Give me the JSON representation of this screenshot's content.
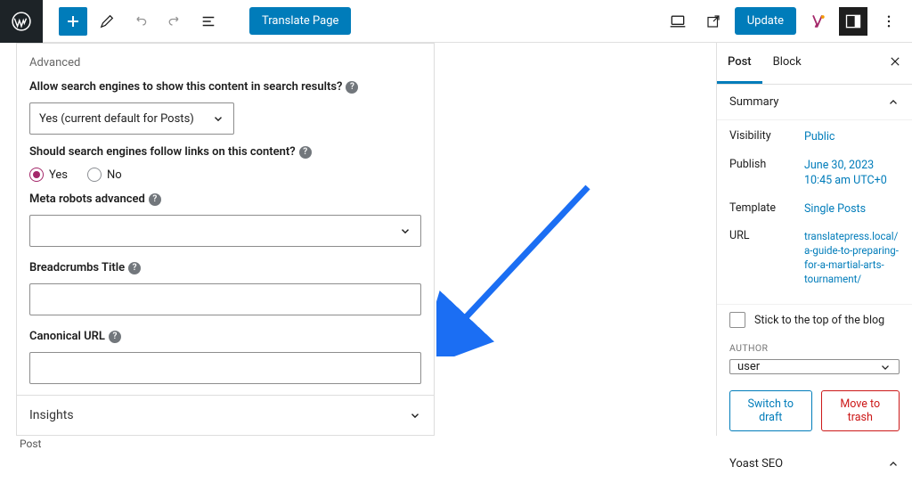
{
  "toolbar": {
    "translate_label": "Translate Page",
    "update_label": "Update"
  },
  "seo": {
    "advanced_header": "Advanced",
    "allow_search_label": "Allow search engines to show this content in search results?",
    "allow_search_value": "Yes (current default for Posts)",
    "follow_links_label": "Should search engines follow links on this content?",
    "radio_yes": "Yes",
    "radio_no": "No",
    "meta_robots_label": "Meta robots advanced",
    "breadcrumbs_label": "Breadcrumbs Title",
    "canonical_label": "Canonical URL",
    "insights_label": "Insights"
  },
  "sidebar": {
    "tabs": {
      "post": "Post",
      "block": "Block"
    },
    "summary_label": "Summary",
    "visibility_k": "Visibility",
    "visibility_v": "Public",
    "publish_k": "Publish",
    "publish_v": "June 30, 2023 10:45 am UTC+0",
    "template_k": "Template",
    "template_v": "Single Posts",
    "url_k": "URL",
    "url_v": "translatepress.local/a-guide-to-preparing-for-a-martial-arts-tournament/",
    "stick_label": "Stick to the top of the blog",
    "author_h": "AUTHOR",
    "author_v": "user",
    "switch_draft": "Switch to draft",
    "move_trash": "Move to trash",
    "yoast_label": "Yoast SEO"
  },
  "footer": {
    "breadcrumb": "Post"
  }
}
